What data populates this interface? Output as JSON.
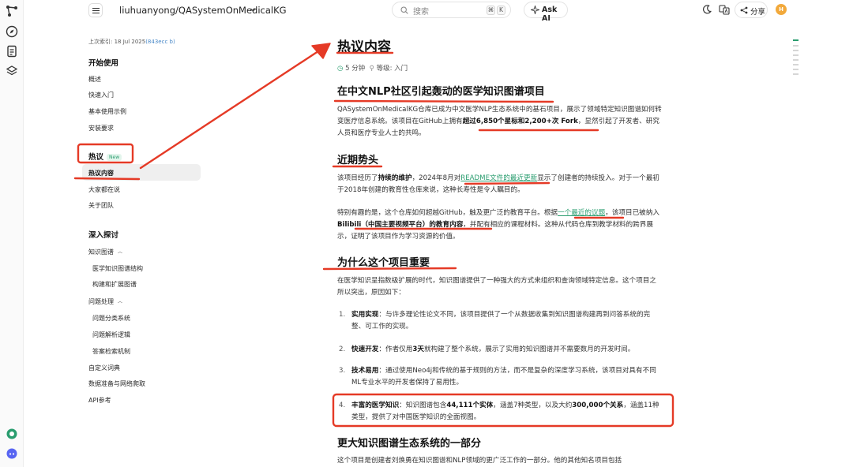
{
  "colors": {
    "accent": "#2a9d6f",
    "annotation_red": "#e53a26",
    "active_bg": "#efefef"
  },
  "rail": {
    "icons": [
      "graph-logo-icon",
      "compass-icon",
      "document-icon",
      "layers-icon",
      "chat-bubble-icon",
      "discord-icon"
    ]
  },
  "topbar": {
    "repo": "liuhuanyong/QASystemOnMedicalKG",
    "search_placeholder": "搜索",
    "search_kbd": [
      "⌘",
      "K"
    ],
    "ask_ai": "Ask AI",
    "share": "分享",
    "avatar": "H"
  },
  "sidebar": {
    "last_indexed_prefix": "上次索引: 18 Jul 2025",
    "last_indexed_hash": "(843ecc b)",
    "sections": {
      "getting_started": "开始使用",
      "hot": "热议",
      "hot_badge": "New",
      "deep_dive": "深入探讨"
    },
    "getting_started_items": [
      "概述",
      "快速入门",
      "基本使用示例",
      "安装要求"
    ],
    "hot_items": [
      "热议内容",
      "大家都在说",
      "关于团队"
    ],
    "deep_items": {
      "kg": "知识图谱",
      "kg_sub": [
        "医学知识图谱结构",
        "构建和扩展图谱"
      ],
      "qp": "问题处理",
      "qp_sub": [
        "问题分类系统",
        "问题解析逻辑",
        "答案检索机制"
      ],
      "rest": [
        "自定义词典",
        "数据准备与网络爬取",
        "API参考"
      ]
    }
  },
  "article": {
    "title": "热议内容",
    "read_time": "5 分钟",
    "level": "等级: 入门",
    "s1_title": "在中文NLP社区引起轰动的医学知识图谱项目",
    "s1_p": {
      "a": "QASystemOnMedicalKG仓库已成为中文医学NLP生态系统中的基石项目，展示了领域特定知识图谱如何转变医疗信息系统。该项目在GitHub上拥有",
      "b": "超过6,850个星标和2,200+次 Fork",
      "c": "，显然引起了开发者、研究人员和医疗专业人士的共鸣。"
    },
    "s2_title": "近期势头",
    "s2_p1": {
      "a": "该项目经历了",
      "b": "持续的维护",
      "c": "，2024年8月对",
      "link": "README文件的最近更新",
      "d": "显示了创建者的持续投入。对于一个最初于2018年创建的教育性仓库来说，这种长寿性是令人瞩目的。"
    },
    "s2_p2": {
      "a": "特别有趣的是，这个仓库如何超越GitHub，触及更广泛的教育平台。根据",
      "link": "一个最近的议题",
      "b": "，该项目已被纳入",
      "c": "Bilibili（中国主要视频平台）的教育内容",
      "d": "，并配有相应的课程材料。这种从代码仓库到教学材料的跨界展示，证明了该项目作为学习资源的价值。"
    },
    "s3_title": "为什么这个项目重要",
    "s3_intro": "在医学知识呈指数级扩展的时代，知识图谱提供了一种强大的方式来组织和查询领域特定信息。这个项目之所以突出，原因如下：",
    "list": [
      {
        "num": "1.",
        "b": "实用实现",
        "t": "：与许多理论性论文不同，该项目提供了一个从数据收集到知识图谱构建再到问答系统的完整、可工作的实现。"
      },
      {
        "num": "2.",
        "b": "快速开发",
        "t1": "：作者仅用",
        "b2": "3天",
        "t2": "就构建了整个系统，展示了实用的知识图谱并不需要数月的开发时间。"
      },
      {
        "num": "3.",
        "b": "技术易用",
        "t": "：通过使用Neo4j和传统的基于规则的方法，而不是复杂的深度学习系统，该项目对具有不同ML专业水平的开发者保持了易用性。"
      },
      {
        "num": "4.",
        "b": "丰富的医学知识",
        "t1": "：知识图谱包含",
        "b2": "44,111个实体",
        "t2": "，涵盖7种类型，以及大约",
        "b3": "300,000个关系",
        "t3": "，涵盖11种类型，提供了对中国医学知识的全面视图。"
      }
    ],
    "s4_title": "更大知识图谱生态系统的一部分",
    "s4_p": "这个项目是创建者刘焕勇在知识图谱和NLP领域的更广泛工作的一部分。他的其他知名项目包括"
  }
}
